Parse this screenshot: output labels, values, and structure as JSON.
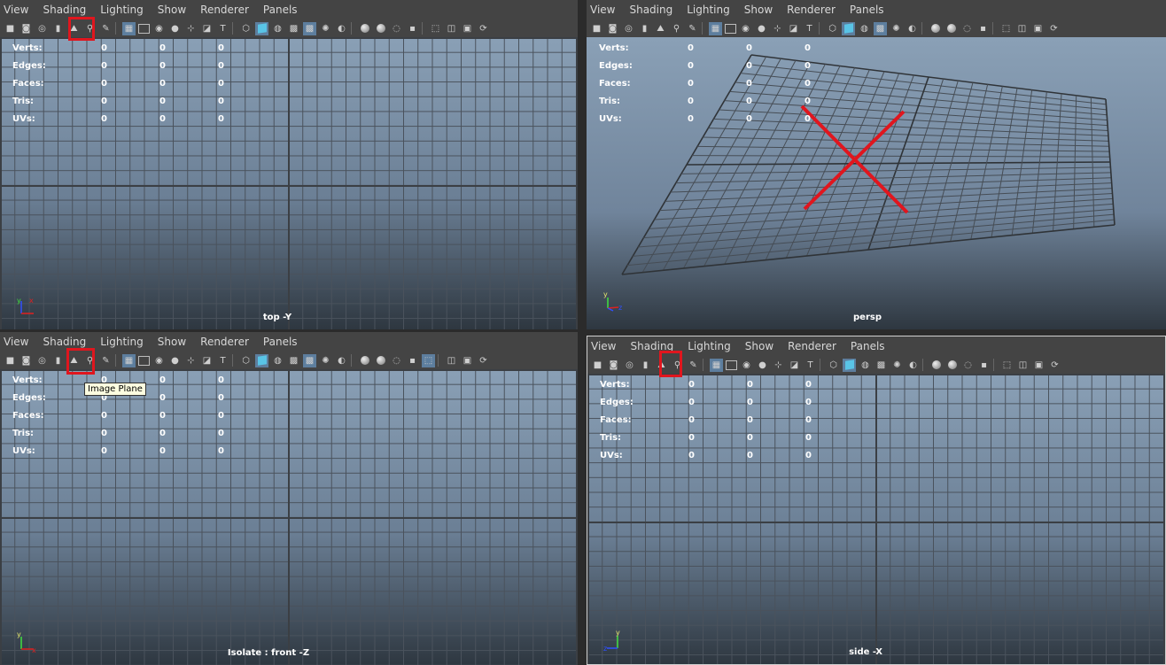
{
  "menus": [
    "View",
    "Shading",
    "Lighting",
    "Show",
    "Renderer",
    "Panels"
  ],
  "hud": {
    "rows": [
      {
        "label": "Verts:",
        "values": [
          "0",
          "0",
          "0"
        ]
      },
      {
        "label": "Edges:",
        "values": [
          "0",
          "0",
          "0"
        ]
      },
      {
        "label": "Faces:",
        "values": [
          "0",
          "0",
          "0"
        ]
      },
      {
        "label": "Tris:",
        "values": [
          "0",
          "0",
          "0"
        ]
      },
      {
        "label": "UVs:",
        "values": [
          "0",
          "0",
          "0"
        ]
      }
    ]
  },
  "panels": {
    "top": {
      "camera_label": "top -Y"
    },
    "persp": {
      "camera_label": "persp"
    },
    "front": {
      "camera_label": "Isolate : front -Z"
    },
    "side": {
      "camera_label": "side -X"
    }
  },
  "tooltip": {
    "text": "Image Plane"
  },
  "axis_labels": {
    "x": "x",
    "y": "y",
    "z": "z"
  },
  "colors": {
    "highlight": "#e0161e",
    "active_button": "#5d7e9e",
    "viewport_top": "#8aa0b6",
    "viewport_bottom": "#2e3740"
  },
  "icons": [
    "camera-icon",
    "camera-attr-icon",
    "bookmark-icon",
    "image-plane-icon",
    "2d-pan-zoom-icon",
    "grease-pencil-icon",
    "grid-icon",
    "film-gate-icon",
    "resolution-gate-icon",
    "gate-mask-icon",
    "field-chart-icon",
    "safe-action-icon",
    "safe-title-icon",
    "wireframe-icon",
    "smooth-shade-icon",
    "default-material-icon",
    "textured-icon",
    "use-all-lights-icon",
    "shadows-icon",
    "screen-space-ao-icon",
    "motion-blur-icon",
    "anti-aliasing-icon",
    "depth-of-field-icon",
    "isolate-select-icon",
    "xray-icon",
    "xray-joints-icon",
    "backface-culling-icon"
  ]
}
